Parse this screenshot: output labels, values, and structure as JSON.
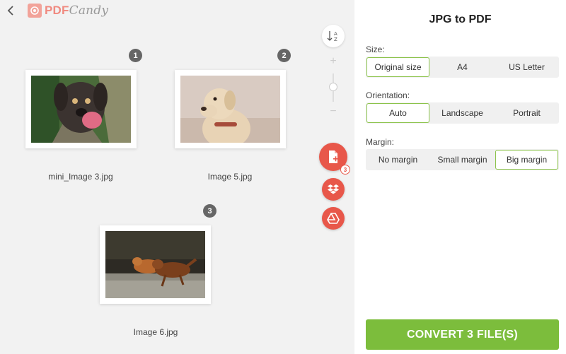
{
  "brand": {
    "logo_main": "PDF",
    "logo_script": "Candy"
  },
  "files": [
    {
      "index": "1",
      "name": "mini_Image 3.jpg"
    },
    {
      "index": "2",
      "name": "Image 5.jpg"
    },
    {
      "index": "3",
      "name": "Image 6.jpg"
    }
  ],
  "tools": {
    "file_count": "3",
    "icons": [
      "sort-az-icon",
      "zoom-plus-icon",
      "zoom-minus-icon",
      "add-file-icon",
      "dropbox-icon",
      "google-drive-icon"
    ]
  },
  "panel": {
    "title": "JPG to PDF",
    "size": {
      "label": "Size:",
      "options": [
        "Original size",
        "A4",
        "US Letter"
      ],
      "selected": "Original size"
    },
    "orientation": {
      "label": "Orientation:",
      "options": [
        "Auto",
        "Landscape",
        "Portrait"
      ],
      "selected": "Auto"
    },
    "margin": {
      "label": "Margin:",
      "options": [
        "No margin",
        "Small margin",
        "Big margin"
      ],
      "selected": "Big margin"
    },
    "convert_label": "CONVERT 3 FILE(S)"
  },
  "colors": {
    "accent_red": "#e8574a",
    "accent_green": "#7cbd3c",
    "active_border": "#8bc34a"
  }
}
